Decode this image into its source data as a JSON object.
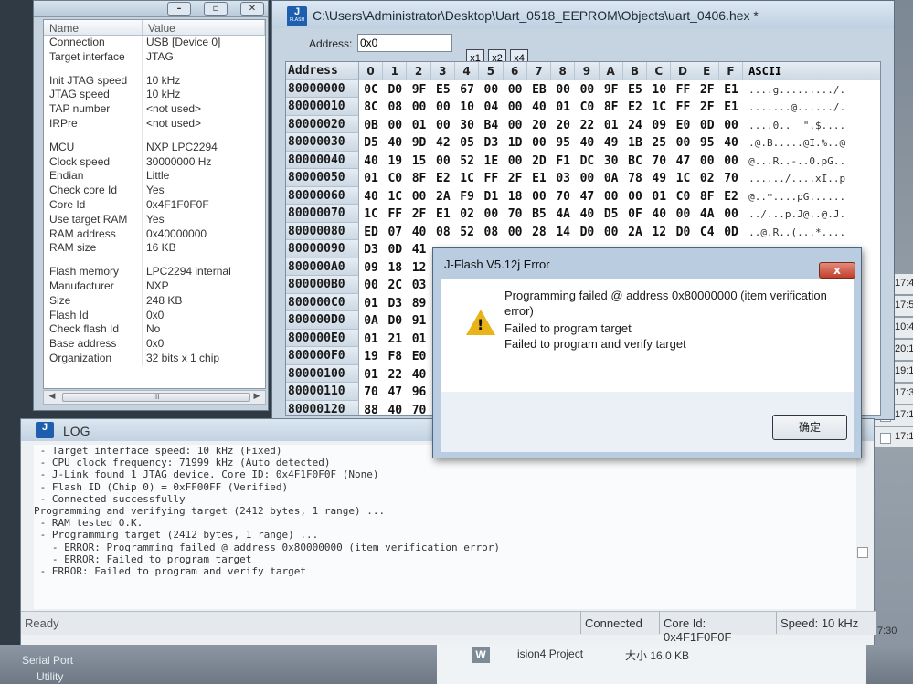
{
  "props_panel": {
    "headers": [
      "Name",
      "Value"
    ],
    "rows": [
      [
        "Connection",
        "USB [Device 0]"
      ],
      [
        "Target interface",
        "JTAG"
      ],
      [
        "",
        ""
      ],
      [
        "Init JTAG speed",
        "10 kHz"
      ],
      [
        "JTAG speed",
        "10 kHz"
      ],
      [
        "TAP number",
        "<not used>"
      ],
      [
        "IRPre",
        "<not used>"
      ],
      [
        "",
        ""
      ],
      [
        "MCU",
        "NXP LPC2294"
      ],
      [
        "Clock speed",
        "30000000 Hz"
      ],
      [
        "Endian",
        "Little"
      ],
      [
        "Check core Id",
        "Yes"
      ],
      [
        "Core Id",
        "0x4F1F0F0F"
      ],
      [
        "Use target RAM",
        "Yes"
      ],
      [
        "RAM address",
        "0x40000000"
      ],
      [
        "RAM size",
        "16 KB"
      ],
      [
        "",
        ""
      ],
      [
        "Flash memory",
        "LPC2294 internal"
      ],
      [
        "Manufacturer",
        "NXP"
      ],
      [
        "Size",
        "248 KB"
      ],
      [
        "Flash Id",
        "0x0"
      ],
      [
        "Check flash Id",
        "No"
      ],
      [
        "Base address",
        "0x0"
      ],
      [
        "Organization",
        "32 bits x 1 chip"
      ]
    ],
    "scroll_thumb": "III"
  },
  "hex_window": {
    "title": "C:\\Users\\Administrator\\Desktop\\Uart_0518_EEPROM\\Objects\\uart_0406.hex *",
    "address_label": "Address:",
    "address_value": "0x0",
    "zoom_buttons": [
      "x1",
      "x2",
      "x4"
    ],
    "column_header": "Address",
    "byte_columns": [
      "0",
      "1",
      "2",
      "3",
      "4",
      "5",
      "6",
      "7",
      "8",
      "9",
      "A",
      "B",
      "C",
      "D",
      "E",
      "F"
    ],
    "ascii_header": "ASCII",
    "rows": [
      {
        "addr": "80000000",
        "bytes": [
          "0C",
          "D0",
          "9F",
          "E5",
          "67",
          "00",
          "00",
          "EB",
          "00",
          "00",
          "9F",
          "E5",
          "10",
          "FF",
          "2F",
          "E1"
        ],
        "ascii": "....g........./."
      },
      {
        "addr": "80000010",
        "bytes": [
          "8C",
          "08",
          "00",
          "00",
          "10",
          "04",
          "00",
          "40",
          "01",
          "C0",
          "8F",
          "E2",
          "1C",
          "FF",
          "2F",
          "E1"
        ],
        "ascii": ".......@....../."
      },
      {
        "addr": "80000020",
        "bytes": [
          "0B",
          "00",
          "01",
          "00",
          "30",
          "B4",
          "00",
          "20",
          "20",
          "22",
          "01",
          "24",
          "09",
          "E0",
          "0D",
          "00"
        ],
        "ascii": "....0..  \".$...."
      },
      {
        "addr": "80000030",
        "bytes": [
          "D5",
          "40",
          "9D",
          "42",
          "05",
          "D3",
          "1D",
          "00",
          "95",
          "40",
          "49",
          "1B",
          "25",
          "00",
          "95",
          "40"
        ],
        "ascii": ".@.B.....@I.%..@"
      },
      {
        "addr": "80000040",
        "bytes": [
          "40",
          "19",
          "15",
          "00",
          "52",
          "1E",
          "00",
          "2D",
          "F1",
          "DC",
          "30",
          "BC",
          "70",
          "47",
          "00",
          "00"
        ],
        "ascii": "@...R..-..0.pG.."
      },
      {
        "addr": "80000050",
        "bytes": [
          "01",
          "C0",
          "8F",
          "E2",
          "1C",
          "FF",
          "2F",
          "E1",
          "03",
          "00",
          "0A",
          "78",
          "49",
          "1C",
          "02",
          "70"
        ],
        "ascii": "....../....xI..p"
      },
      {
        "addr": "80000060",
        "bytes": [
          "40",
          "1C",
          "00",
          "2A",
          "F9",
          "D1",
          "18",
          "00",
          "70",
          "47",
          "00",
          "00",
          "01",
          "C0",
          "8F",
          "E2"
        ],
        "ascii": "@..*....pG......"
      },
      {
        "addr": "80000070",
        "bytes": [
          "1C",
          "FF",
          "2F",
          "E1",
          "02",
          "00",
          "70",
          "B5",
          "4A",
          "40",
          "D5",
          "0F",
          "40",
          "00",
          "4A",
          "00"
        ],
        "ascii": "../...p.J@..@.J."
      },
      {
        "addr": "80000080",
        "bytes": [
          "ED",
          "07",
          "40",
          "08",
          "52",
          "08",
          "00",
          "28",
          "14",
          "D0",
          "00",
          "2A",
          "12",
          "D0",
          "C4",
          "0D"
        ],
        "ascii": "..@.R..(...*...."
      },
      {
        "addr": "80000090",
        "bytes": [
          "D3",
          "0D",
          "41",
          "",
          "",
          "",
          "",
          "",
          "",
          "",
          "",
          "",
          "",
          "",
          "",
          ""
        ],
        "ascii": ""
      },
      {
        "addr": "800000A0",
        "bytes": [
          "09",
          "18",
          "12",
          "",
          "",
          "",
          "",
          "",
          "",
          "",
          "",
          "",
          "",
          "",
          "",
          ""
        ],
        "ascii": ""
      },
      {
        "addr": "800000B0",
        "bytes": [
          "00",
          "2C",
          "03",
          "",
          "",
          "",
          "",
          "",
          "",
          "",
          "",
          "",
          "",
          "",
          "",
          ""
        ],
        "ascii": ""
      },
      {
        "addr": "800000C0",
        "bytes": [
          "01",
          "D3",
          "89",
          "",
          "",
          "",
          "",
          "",
          "",
          "",
          "",
          "",
          "",
          "",
          "",
          ""
        ],
        "ascii": ""
      },
      {
        "addr": "800000D0",
        "bytes": [
          "0A",
          "D0",
          "91",
          "",
          "",
          "",
          "",
          "",
          "",
          "",
          "",
          "",
          "",
          "",
          "",
          ""
        ],
        "ascii": ""
      },
      {
        "addr": "800000E0",
        "bytes": [
          "01",
          "21",
          "01",
          "",
          "",
          "",
          "",
          "",
          "",
          "",
          "",
          "",
          "",
          "",
          "",
          ""
        ],
        "ascii": ""
      },
      {
        "addr": "800000F0",
        "bytes": [
          "19",
          "F8",
          "E0",
          "",
          "",
          "",
          "",
          "",
          "",
          "",
          "",
          "",
          "",
          "",
          "",
          ""
        ],
        "ascii": ""
      },
      {
        "addr": "80000100",
        "bytes": [
          "01",
          "22",
          "40",
          "",
          "",
          "",
          "",
          "",
          "",
          "",
          "",
          "",
          "",
          "",
          "",
          ""
        ],
        "ascii": ""
      },
      {
        "addr": "80000110",
        "bytes": [
          "70",
          "47",
          "96",
          "",
          "",
          "",
          "",
          "",
          "",
          "",
          "",
          "",
          "",
          "",
          "",
          ""
        ],
        "ascii": ""
      },
      {
        "addr": "80000120",
        "bytes": [
          "88",
          "40",
          "70",
          "",
          "",
          "",
          "",
          "",
          "",
          "",
          "",
          "",
          "",
          "",
          "",
          ""
        ],
        "ascii": ""
      }
    ]
  },
  "log_window": {
    "title": "LOG",
    "lines": [
      " - Target interface speed: 10 kHz (Fixed)",
      " - CPU clock frequency: 71999 kHz (Auto detected)",
      " - J-Link found 1 JTAG device. Core ID: 0x4F1F0F0F (None)",
      " - Flash ID (Chip 0) = 0xFF00FF (Verified)",
      " - Connected successfully",
      "Programming and verifying target (2412 bytes, 1 range) ...",
      " - RAM tested O.K.",
      " - Programming target (2412 bytes, 1 range) ...",
      "   - ERROR: Programming failed @ address 0x80000000 (item verification error)",
      "   - ERROR: Failed to program target",
      " - ERROR: Failed to program and verify target"
    ]
  },
  "status_bar": {
    "ready": "Ready",
    "connected": "Connected",
    "core_id": "Core Id: 0x4F1F0F0F",
    "speed": "Speed: 10 kHz"
  },
  "dialog": {
    "title": "J-Flash V5.12j Error",
    "close_label": "x",
    "messages": [
      "Programming failed @ address 0x80000000 (item verification error)",
      "Failed to program target",
      "Failed to program and verify target"
    ],
    "ok_label": "确定"
  },
  "desktop": {
    "side_times": [
      "17:4",
      "17:5",
      "10:4",
      "20:1",
      "19:11",
      "17:3",
      "17:1",
      "17:1"
    ],
    "clock_fragment": "7:30",
    "serial_port_label": "Serial Port",
    "utility_label": "Utility",
    "taskbar_item_name": "ision4 Project",
    "taskbar_item_size": "大小 16.0 KB",
    "icon_letter": "W"
  },
  "logo": {
    "letter": "J",
    "sub": "FLASH"
  }
}
